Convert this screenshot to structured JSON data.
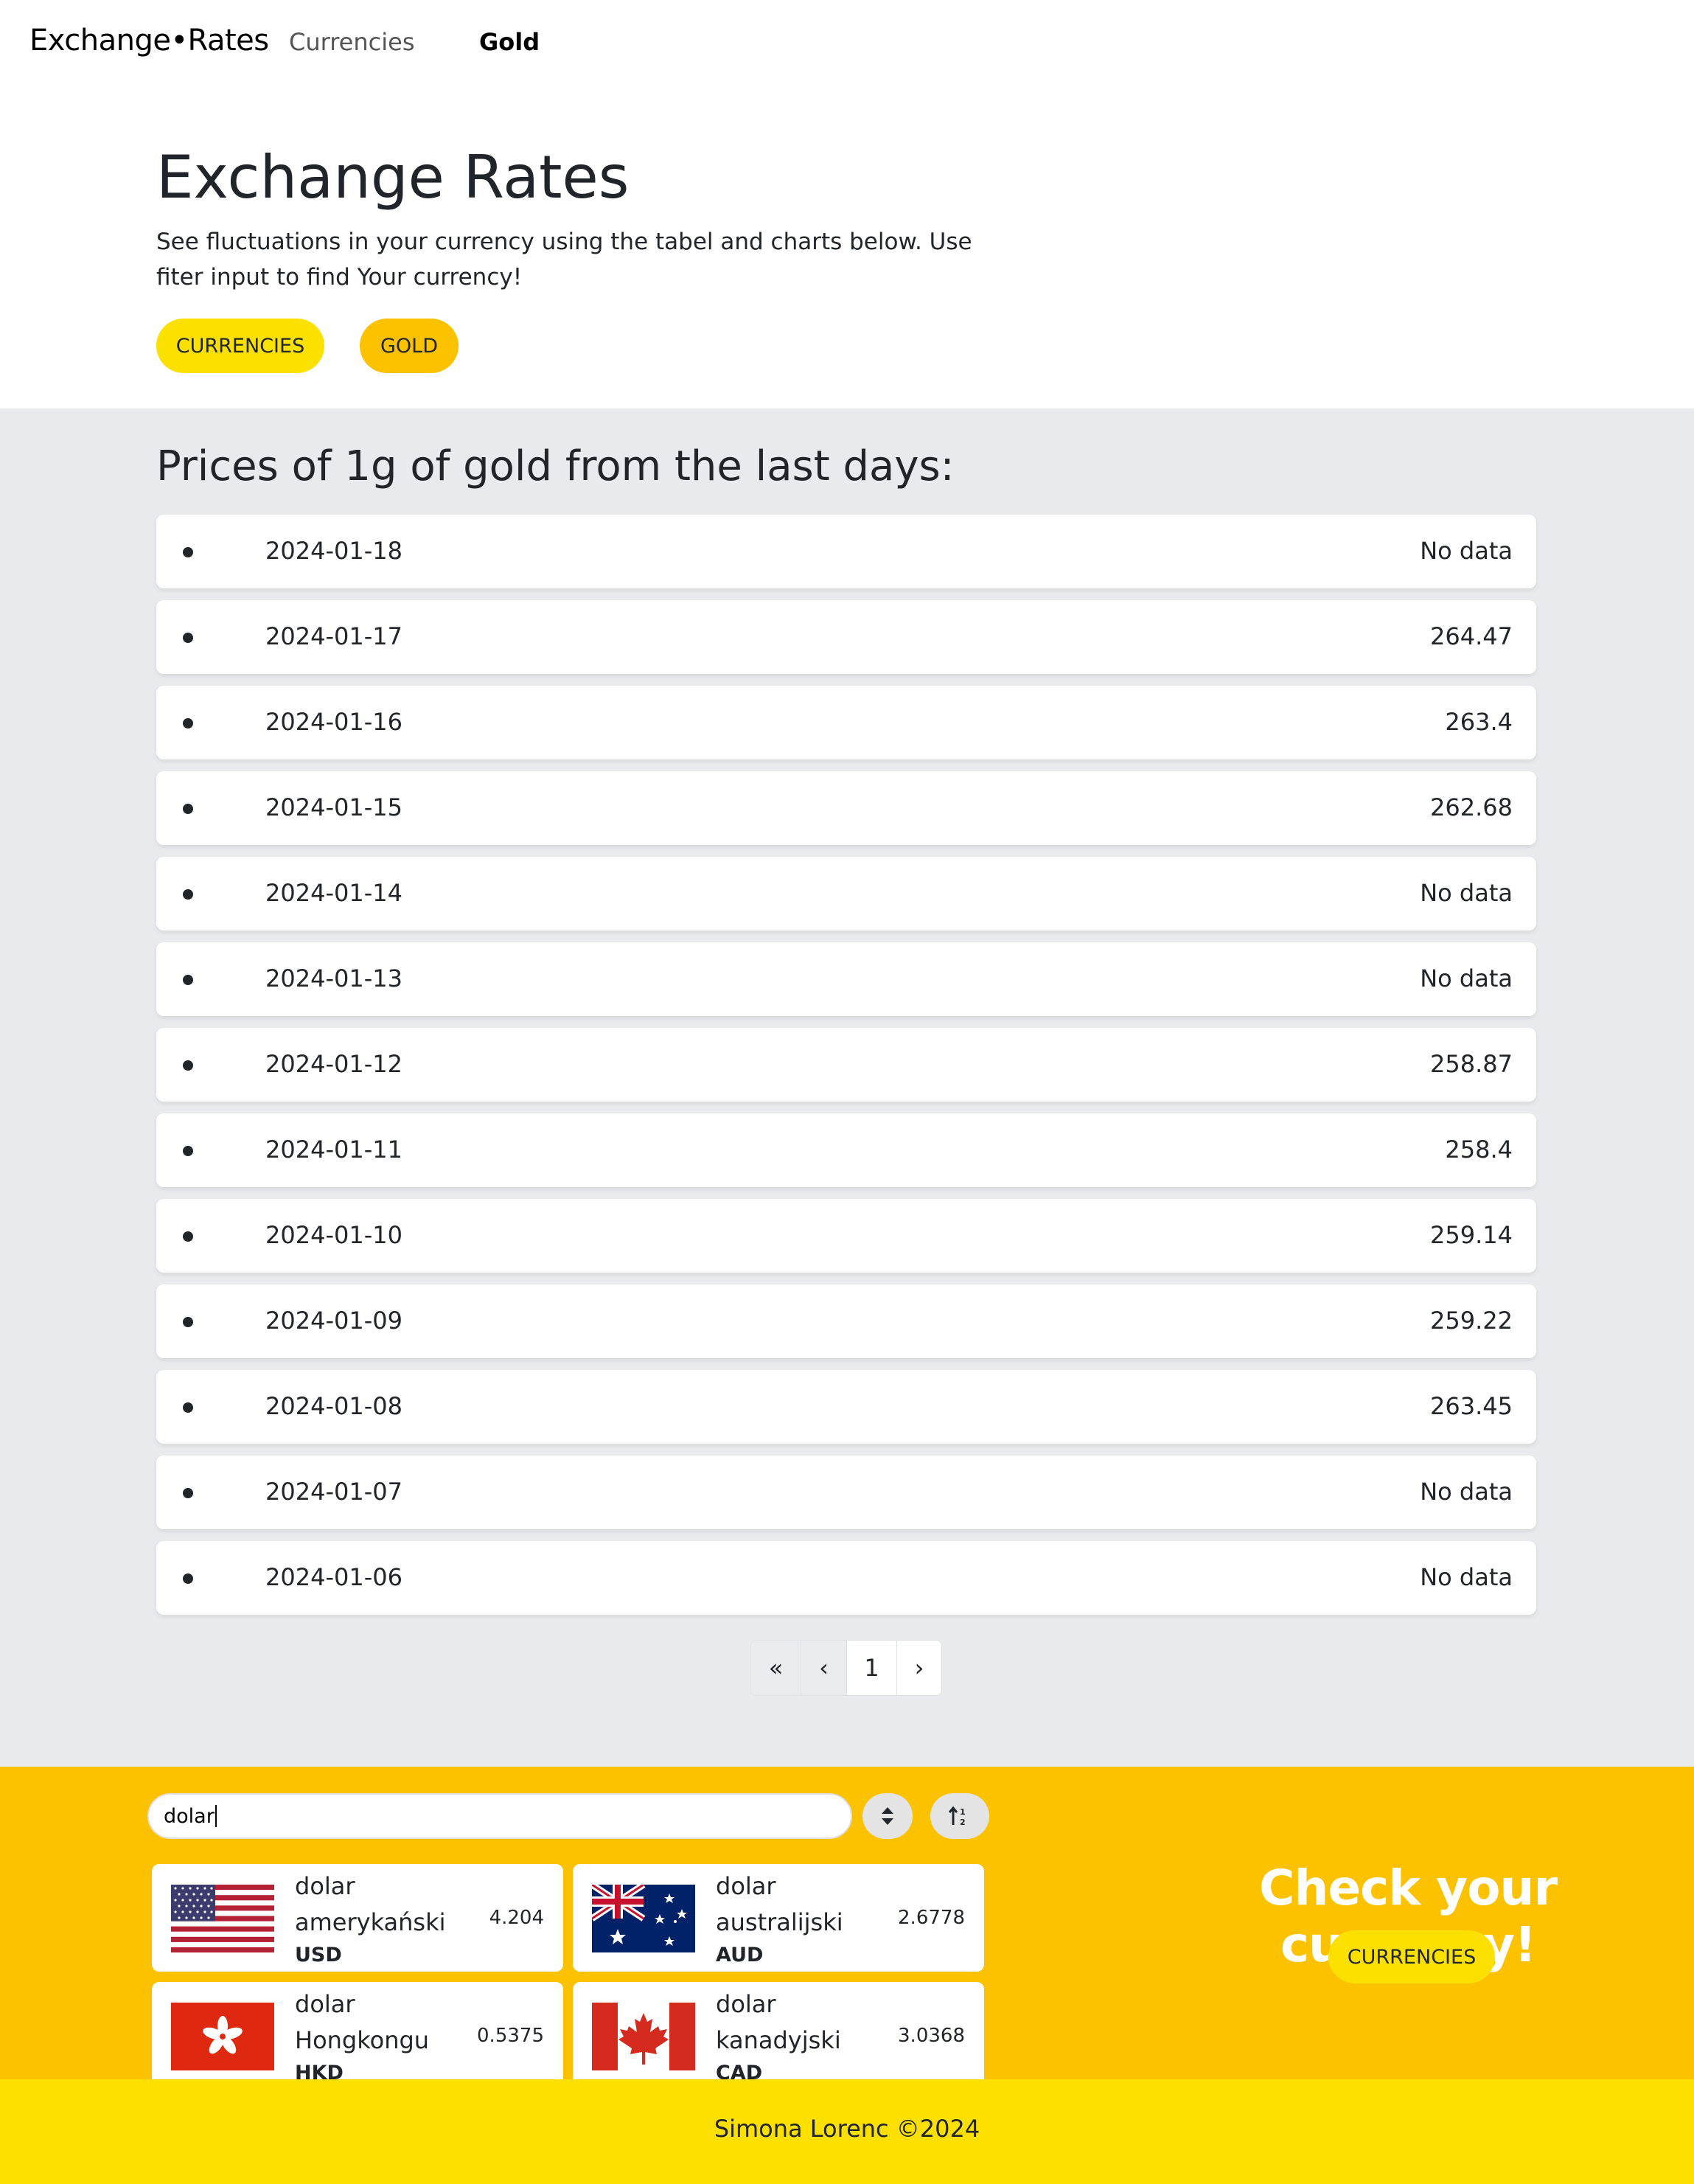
{
  "navbar": {
    "brand": "Exchange•Rates",
    "links": [
      {
        "label": "Currencies"
      },
      {
        "label": "Gold"
      }
    ]
  },
  "hero": {
    "title": "Exchange Rates",
    "text": "See fluctuations in your currency using the tabel and charts below. Use fiter input to find Your currency!",
    "buttons": [
      {
        "label": "CURRENCIES",
        "color": "#fce100"
      },
      {
        "label": "GOLD",
        "color": "#fcc200"
      }
    ]
  },
  "gold": {
    "title": "Prices of 1g of gold from the last days:",
    "rows": [
      {
        "date": "2024-01-18",
        "price": "No data"
      },
      {
        "date": "2024-01-17",
        "price": "264.47"
      },
      {
        "date": "2024-01-16",
        "price": "263.4"
      },
      {
        "date": "2024-01-15",
        "price": "262.68"
      },
      {
        "date": "2024-01-14",
        "price": "No data"
      },
      {
        "date": "2024-01-13",
        "price": "No data"
      },
      {
        "date": "2024-01-12",
        "price": "258.87"
      },
      {
        "date": "2024-01-11",
        "price": "258.4"
      },
      {
        "date": "2024-01-10",
        "price": "259.14"
      },
      {
        "date": "2024-01-09",
        "price": "259.22"
      },
      {
        "date": "2024-01-08",
        "price": "263.45"
      },
      {
        "date": "2024-01-07",
        "price": "No data"
      },
      {
        "date": "2024-01-06",
        "price": "No data"
      }
    ],
    "pagination": {
      "first": "«",
      "prev": "‹",
      "current": "1",
      "next": "›"
    }
  },
  "currencies": {
    "search_value": "dolar",
    "sort_icon_a": "sort-up-down-icon",
    "sort_icon_b": "sort-numeric-icon",
    "cards": [
      {
        "name": "dolar amerykański",
        "code": "USD",
        "rate": "4.204",
        "flag": "us-flag-icon"
      },
      {
        "name": "dolar australijski",
        "code": "AUD",
        "rate": "2.6778",
        "flag": "au-flag-icon"
      },
      {
        "name": "dolar Hongkongu",
        "code": "HKD",
        "rate": "0.5375",
        "flag": "hk-flag-icon"
      },
      {
        "name": "dolar kanadyjski",
        "code": "CAD",
        "rate": "3.0368",
        "flag": "ca-flag-icon"
      }
    ],
    "cta_title": "Check your currency!",
    "cta_button": "CURRENCIES"
  },
  "footer": {
    "text": "Simona Lorenc ©2024"
  },
  "colors": {
    "accent_yellow": "#fce100",
    "accent_gold": "#fcc200",
    "section_gray": "#e9eaed",
    "footer_yellow": "#fde000"
  }
}
